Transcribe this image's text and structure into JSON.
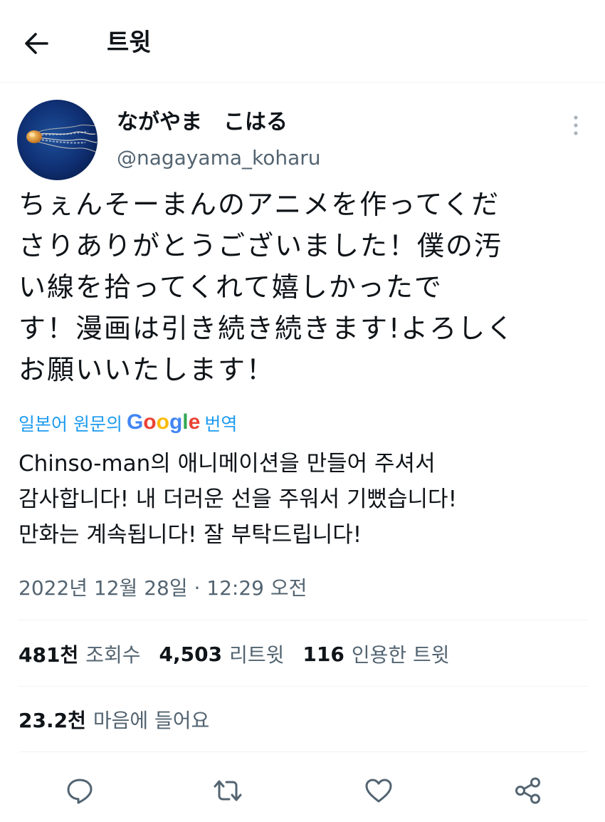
{
  "header": {
    "title": "트윗",
    "back_icon": "arrow-left-icon"
  },
  "author": {
    "display_name": "ながやま　こはる",
    "handle": "@nagayama_koharu",
    "avatar_icon": "jellyfish-avatar"
  },
  "tweet": {
    "text_lines": [
      "ちぇんそーまんのアニメを作ってくだ",
      "さりありがとうございました！僕の汚",
      "い線を拾ってくれて嬉しかったで",
      "す！漫画は引き続き続きます!よろしく",
      "お願いいたします！"
    ],
    "translate_prefix": "일본어 원문의",
    "translate_logo": "Google",
    "translate_suffix": "번역",
    "translated_lines": [
      "Chinso-man의 애니메이션을 만들어 주셔서",
      "감사합니다! 내 더러운 선을 주워서 기뻤습니다!",
      "만화는 계속됩니다! 잘 부탁드립니다!"
    ],
    "timestamp": "2022년 12월 28일 · 12:29 오전"
  },
  "stats": {
    "views_count": "481천",
    "views_label": "조회수",
    "retweets_count": "4,503",
    "retweets_label": "리트윗",
    "quotes_count": "116",
    "quotes_label": "인용한 트윗",
    "likes_count": "23.2천",
    "likes_label": "마음에 들어요"
  },
  "actions": [
    "reply-icon",
    "retweet-icon",
    "like-icon",
    "share-icon"
  ],
  "colors": {
    "text": "#0f1419",
    "secondary": "#536471",
    "link": "#1d9bf0",
    "divider": "#eff3f4"
  }
}
